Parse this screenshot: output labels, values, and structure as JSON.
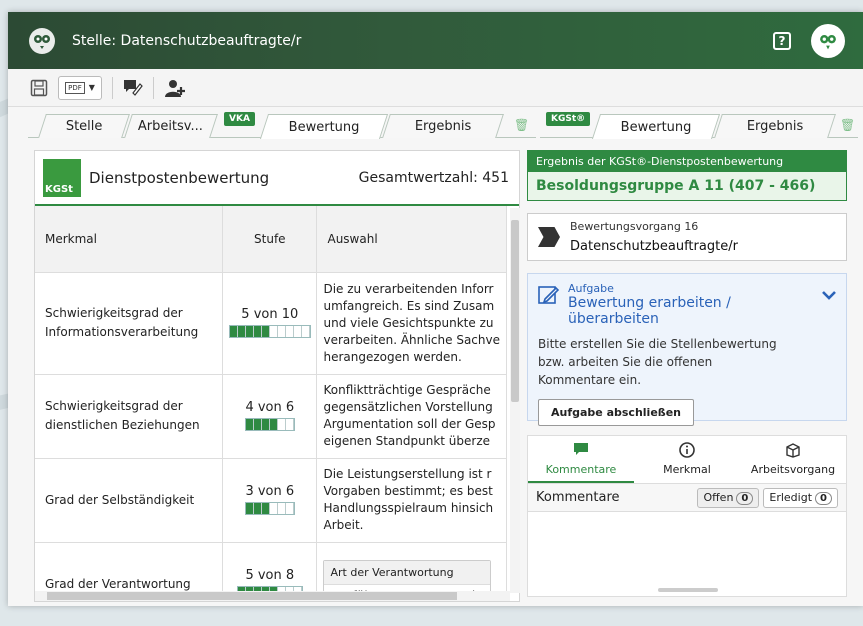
{
  "window": {
    "title": "Stelle: Datenschutzbeauftragte/r",
    "help_label": "?"
  },
  "toolbar": {
    "save_icon": "save-icon",
    "pdf_label": "PDF",
    "comment_icon": "comment-tool-icon",
    "user_icon": "add-user-icon"
  },
  "tabs_left": {
    "badge": "VKA",
    "items": [
      "Stelle",
      "Arbeitsv...",
      "Bewertung",
      "Ergebnis"
    ],
    "active_index": 2
  },
  "tabs_right": {
    "badge": "KGSt®",
    "items": [
      "Bewertung",
      "Ergebnis"
    ],
    "active_index": 0
  },
  "left_panel": {
    "logo_text": "KGSt",
    "title": "Dienstpostenbewertung",
    "total": "Gesamtwertzahl: 451",
    "columns": [
      "Merkmal",
      "Stufe",
      "Auswahl"
    ],
    "rows": [
      {
        "merkmal": "Schwierigkeitsgrad der Informationsverarbeitung",
        "stufe": "5 von 10",
        "level": 5,
        "max": 10,
        "auswahl": [
          "Die zu verarbeitenden Inforr",
          "umfangreich. Es sind Zusam",
          "und viele Gesichtspunkte zu",
          "verarbeiten. Ähnliche Sachve",
          "herangezogen werden."
        ]
      },
      {
        "merkmal": "Schwierigkeitsgrad der dienstlichen Beziehungen",
        "stufe": "4 von 6",
        "level": 4,
        "max": 6,
        "auswahl": [
          "Konfliktträchtige Gespräche",
          "gegensätzlichen Vorstellung",
          "Argumentation soll der Gesp",
          "eigenen Standpunkt überze"
        ]
      },
      {
        "merkmal": "Grad der Selbständigkeit",
        "stufe": "3 von 6",
        "level": 3,
        "max": 6,
        "auswahl": [
          "Die Leistungserstellung ist r",
          "Vorgaben bestimmt; es best",
          "Handlungsspielraum hinsich",
          "Arbeit."
        ]
      },
      {
        "merkmal": "Grad der Verantwortung",
        "stufe": "5 von 8",
        "level": 5,
        "max": 8,
        "select_caption": "Art der Verantwortung",
        "select_value": "Ausführungsverantworti"
      }
    ]
  },
  "result": {
    "heading": "Ergebnis der KGSt®-Dienstpostenbewertung",
    "value": "Besoldungsgruppe A 11 (407 - 466)"
  },
  "vorgang": {
    "line1": "Bewertungsvorgang 16",
    "line2": "Datenschutzbeauftragte/r"
  },
  "aufgabe": {
    "small": "Aufgabe",
    "title": "Bewertung erarbeiten / überarbeiten",
    "text": [
      "Bitte erstellen Sie die Stellenbewertung",
      "bzw. arbeiten Sie die offenen",
      "Kommentare ein."
    ],
    "button": "Aufgabe abschließen"
  },
  "bottom_tabs": {
    "items": [
      "Kommentare",
      "Merkmal",
      "Arbeitsvorgang"
    ],
    "active_index": 0
  },
  "comments": {
    "title": "Kommentare",
    "open_label": "Offen",
    "open_count": "0",
    "done_label": "Erledigt",
    "done_count": "0"
  },
  "colors": {
    "accent": "#2f8a42",
    "titlebar": "#2e5a3a",
    "info_blue": "#2a62b8"
  }
}
